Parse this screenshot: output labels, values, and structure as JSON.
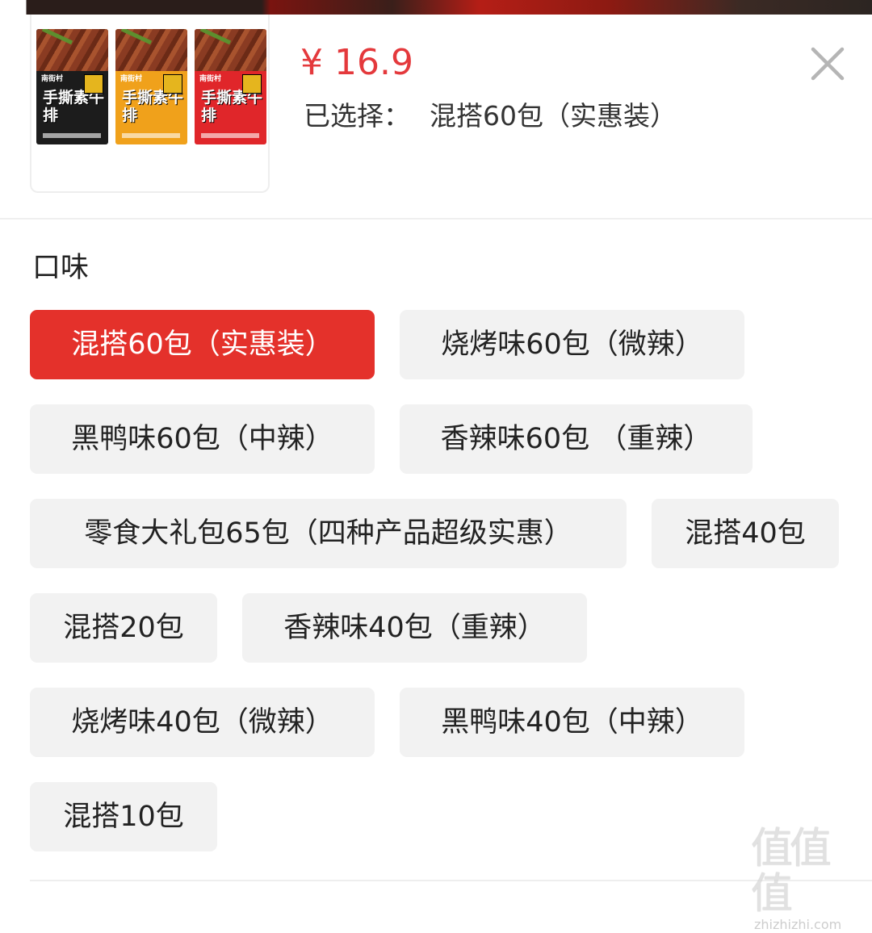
{
  "product": {
    "price": "¥ 16.9",
    "selected_label": "已选择：",
    "selected_value": "混搭60包（实惠装）",
    "images": [
      {
        "brand": "南街村",
        "name": "手撕素牛排",
        "color": "#1c1c1c"
      },
      {
        "brand": "南街村",
        "name": "手撕素牛排",
        "color": "#f0a11b"
      },
      {
        "brand": "南街村",
        "name": "手撕素牛排",
        "color": "#e0262a"
      }
    ]
  },
  "section": {
    "title": "口味"
  },
  "options": [
    {
      "label": "混搭60包（实惠装）",
      "selected": true
    },
    {
      "label": "烧烤味60包（微辣）",
      "selected": false
    },
    {
      "label": "黑鸭味60包（中辣）",
      "selected": false
    },
    {
      "label": "香辣味60包 （重辣）",
      "selected": false
    },
    {
      "label": "零食大礼包65包（四种产品超级实惠）",
      "selected": false
    },
    {
      "label": "混搭40包",
      "selected": false
    },
    {
      "label": "混搭20包",
      "selected": false
    },
    {
      "label": "香辣味40包（重辣）",
      "selected": false
    },
    {
      "label": "烧烤味40包（微辣）",
      "selected": false
    },
    {
      "label": "黑鸭味40包（中辣）",
      "selected": false
    },
    {
      "label": "混搭10包",
      "selected": false
    }
  ],
  "colors": {
    "accent": "#e4312b",
    "price": "#e4393c",
    "option_bg": "#f2f2f2"
  },
  "watermark": {
    "glyphs": "值值值",
    "url": "zhizhizhi.com"
  }
}
